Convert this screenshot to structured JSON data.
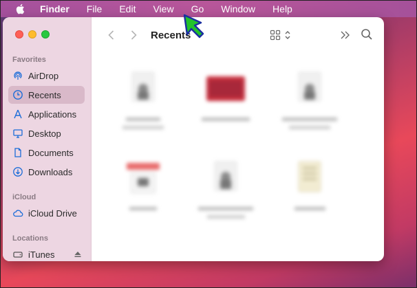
{
  "menubar": {
    "apple_icon": "apple-icon",
    "items": [
      "Finder",
      "File",
      "Edit",
      "View",
      "Go",
      "Window",
      "Help"
    ]
  },
  "window": {
    "title": "Recents",
    "toolbar_icons": [
      "back-chevron-icon",
      "forward-chevron-icon",
      "grid-view-icon",
      "more-chevron-icon",
      "search-icon"
    ]
  },
  "sidebar": {
    "favorites_label": "Favorites",
    "favorites": [
      {
        "label": "AirDrop",
        "icon": "airdrop-icon"
      },
      {
        "label": "Recents",
        "icon": "clock-icon",
        "selected": true
      },
      {
        "label": "Applications",
        "icon": "applications-icon"
      },
      {
        "label": "Desktop",
        "icon": "desktop-icon"
      },
      {
        "label": "Documents",
        "icon": "document-icon"
      },
      {
        "label": "Downloads",
        "icon": "download-icon"
      }
    ],
    "icloud_label": "iCloud",
    "icloud": [
      {
        "label": "iCloud Drive",
        "icon": "cloud-icon"
      }
    ],
    "locations_label": "Locations",
    "locations": [
      {
        "label": "iTunes",
        "icon": "disk-icon"
      }
    ]
  },
  "colors": {
    "menubar": "#b8569a",
    "sidebar": "#edd6e2",
    "selected": "#d9b9c9",
    "accent": "#1a6cd8",
    "cursor": "#22c22a"
  }
}
